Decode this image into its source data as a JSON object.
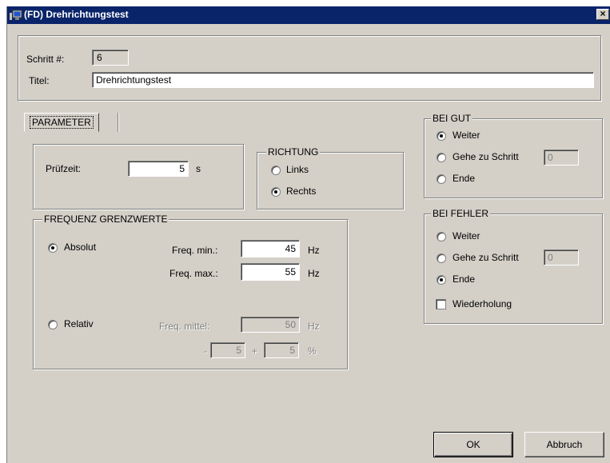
{
  "window": {
    "title": "(FD) Drehrichtungstest",
    "close_label": "×"
  },
  "header": {
    "step_label": "Schritt #:",
    "step_value": "6",
    "title_label": "Titel:",
    "title_value": "Drehrichtungstest"
  },
  "tabs": [
    {
      "label": "PARAMETER",
      "active": true
    }
  ],
  "test_time": {
    "label": "Prüfzeit:",
    "value": "5",
    "unit": "s"
  },
  "direction": {
    "legend": "RICHTUNG",
    "options": [
      {
        "label": "Links",
        "selected": false
      },
      {
        "label": "Rechts",
        "selected": true
      }
    ]
  },
  "frequency": {
    "legend": "FREQUENZ GRENZWERTE",
    "absolute": {
      "label": "Absolut",
      "selected": true
    },
    "relative": {
      "label": "Relativ",
      "selected": false
    },
    "min": {
      "label": "Freq. min.:",
      "value": "45",
      "unit": "Hz"
    },
    "max": {
      "label": "Freq. max.:",
      "value": "55",
      "unit": "Hz"
    },
    "mid": {
      "label": "Freq. mittel:",
      "value": "50",
      "unit": "Hz"
    },
    "tol_minus": {
      "sign": "-",
      "value": "5"
    },
    "tol_plus": {
      "sign": "+",
      "value": "5",
      "unit": "%"
    }
  },
  "on_good": {
    "legend": "BEI GUT",
    "options": [
      {
        "label": "Weiter",
        "selected": true
      },
      {
        "label": "Gehe zu Schritt",
        "selected": false
      },
      {
        "label": "Ende",
        "selected": false
      }
    ],
    "goto_value": "0"
  },
  "on_error": {
    "legend": "BEI FEHLER",
    "options": [
      {
        "label": "Weiter",
        "selected": false
      },
      {
        "label": "Gehe zu Schritt",
        "selected": false
      },
      {
        "label": "Ende",
        "selected": true
      }
    ],
    "goto_value": "0",
    "repeat": {
      "label": "Wiederholung",
      "checked": false
    }
  },
  "buttons": {
    "ok": "OK",
    "cancel": "Abbruch"
  },
  "colors": {
    "face": "#d4d0c8",
    "titlebar": "#0a246a"
  },
  "icons": {
    "app": "monitor-icon",
    "close": "close-icon"
  }
}
